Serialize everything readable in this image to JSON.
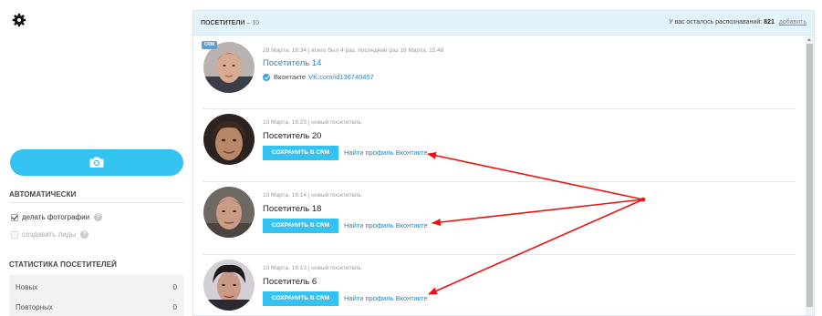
{
  "sidebar": {
    "auto_title": "АВТОМАТИЧЕСКИ",
    "options": [
      {
        "label": "делать фотографии",
        "checked": true
      },
      {
        "label": "создавать лиды",
        "checked": false
      }
    ],
    "help_glyph": "?",
    "stats_title": "СТАТИСТИКА ПОСЕТИТЕЛЕЙ",
    "stats": [
      {
        "label": "Новых",
        "value": "0"
      },
      {
        "label": "Повторных",
        "value": "0"
      }
    ]
  },
  "header": {
    "title": "ПОСЕТИТЕЛИ",
    "count": "– 10",
    "remaining_label": "У вас осталось распознаваний:",
    "remaining_value": "821",
    "add_link": "добавить"
  },
  "visitors": [
    {
      "crm_badge": "CRM",
      "meta": "28 Марта, 16:34 | всего был 4 раз, последний раз 16 Марта, 15:48",
      "name": "Посетитель 14",
      "vk_label": "Вконтакте",
      "vk_link": "VK.com/id136740457"
    },
    {
      "meta": "10 Марта, 16:23 | новый посетитель",
      "name": "Посетитель 20",
      "save_label": "СОХРАНИТЬ В CRM",
      "find_label": "Найти профиль Вконтакте"
    },
    {
      "meta": "10 Марта, 16:14 | новый посетитель",
      "name": "Посетитель 18",
      "save_label": "СОХРАНИТЬ В CRM",
      "find_label": "Найти профиль Вконтакте"
    },
    {
      "meta": "10 Марта, 16:13 | новый посетитель",
      "name": "Посетитель 6",
      "save_label": "СОХРАНИТЬ В CRM",
      "find_label": "Найти профиль Вконтакте"
    }
  ],
  "colors": {
    "accent": "#34c3f0",
    "link": "#2a83c6",
    "header_bg": "#e3f3fb",
    "annotation": "#ee1111"
  },
  "icons": [
    "gear-icon",
    "camera-icon",
    "check-icon",
    "help-icon",
    "verified-icon"
  ]
}
